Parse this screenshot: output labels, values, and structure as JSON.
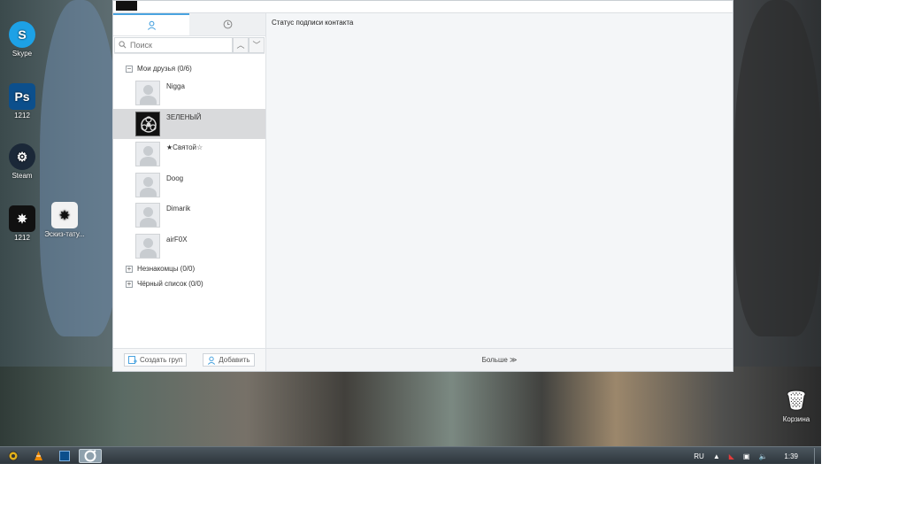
{
  "desktop": {
    "icons": [
      {
        "label": "Skype",
        "glyph": "S",
        "color": "#1da1e6"
      },
      {
        "label": "1212",
        "glyph": "Ps",
        "color": "#0c4f8c"
      },
      {
        "label": "Steam",
        "glyph": "⚙",
        "color": "#1b2838"
      },
      {
        "label": "1212",
        "glyph": "✵",
        "color": "#111111"
      },
      {
        "label": "Эскиз-тату...",
        "glyph": "✵",
        "color": "#f2f2f2"
      },
      {
        "label": "Корзина",
        "glyph": "🗑",
        "color": "#8aa0b0"
      }
    ]
  },
  "window": {
    "search": {
      "placeholder": "Поиск"
    },
    "groups": [
      {
        "label": "Мои друзья (0/6)",
        "toggle": "−"
      },
      {
        "label": "Незнакомцы (0/0)",
        "toggle": "+"
      },
      {
        "label": "Чёрный список (0/0)",
        "toggle": "+"
      }
    ],
    "friends": [
      {
        "name": "Nigga"
      },
      {
        "name": "ЗЕЛЕНЫЙ"
      },
      {
        "name": "★Cвятoй☆"
      },
      {
        "name": "Doog"
      },
      {
        "name": "Dimarik"
      },
      {
        "name": "airF0X"
      }
    ],
    "footer": {
      "create_group": "Создать груп",
      "add": "Добавить"
    },
    "detail": {
      "status_label": "Статус подписи контакта",
      "more": "Больше ≫"
    }
  },
  "taskbar": {
    "tray": {
      "lang": "RU",
      "clock": "1:39"
    }
  },
  "colors": {
    "accent": "#4aa3df",
    "selected_row": "#d9dadc"
  }
}
